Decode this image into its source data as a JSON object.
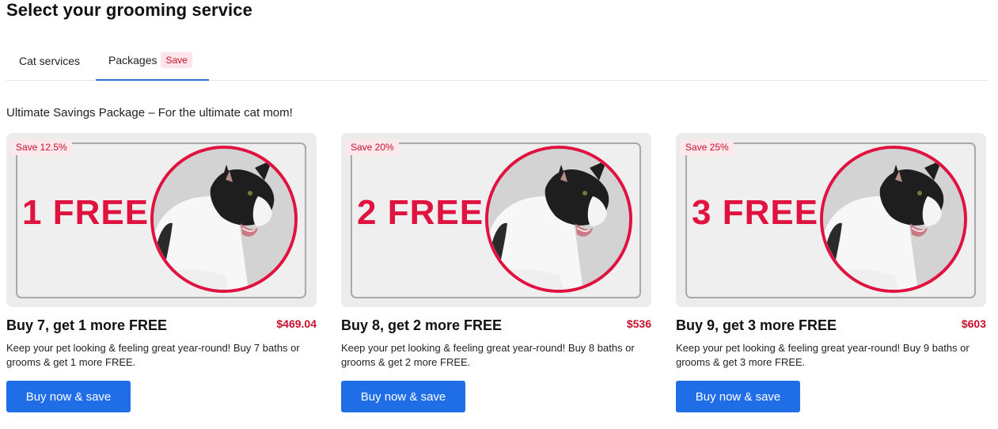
{
  "page": {
    "title": "Select your grooming service"
  },
  "tabs": [
    {
      "label": "Cat services"
    },
    {
      "label": "Packages",
      "badge": "Save"
    }
  ],
  "section": {
    "subtitle": "Ultimate Savings Package – For the ultimate cat mom!"
  },
  "cards": [
    {
      "save_badge": "Save 12.5%",
      "banner_text": "1 FREE",
      "title": "Buy 7, get 1 more FREE",
      "price": "$469.04",
      "description": "Keep your pet looking & feeling great year-round! Buy 7 baths or grooms & get 1 more FREE.",
      "button_label": "Buy now & save"
    },
    {
      "save_badge": "Save 20%",
      "banner_text": "2 FREE",
      "title": "Buy 8, get 2 more FREE",
      "price": "$536",
      "description": "Keep your pet looking & feeling great year-round! Buy 8 baths or grooms & get 2 more FREE.",
      "button_label": "Buy now & save"
    },
    {
      "save_badge": "Save 25%",
      "banner_text": "3 FREE",
      "title": "Buy 9, get 3 more FREE",
      "price": "$603",
      "description": "Keep your pet looking & feeling great year-round! Buy 9 baths or grooms & get 3 more FREE.",
      "button_label": "Buy now & save"
    }
  ],
  "colors": {
    "accent_red": "#e0123f",
    "price_red": "#c8102e",
    "button_blue": "#1f6ee8",
    "tab_underline": "#2f6fd6"
  },
  "icons": {
    "card_image": "cat-photo"
  }
}
